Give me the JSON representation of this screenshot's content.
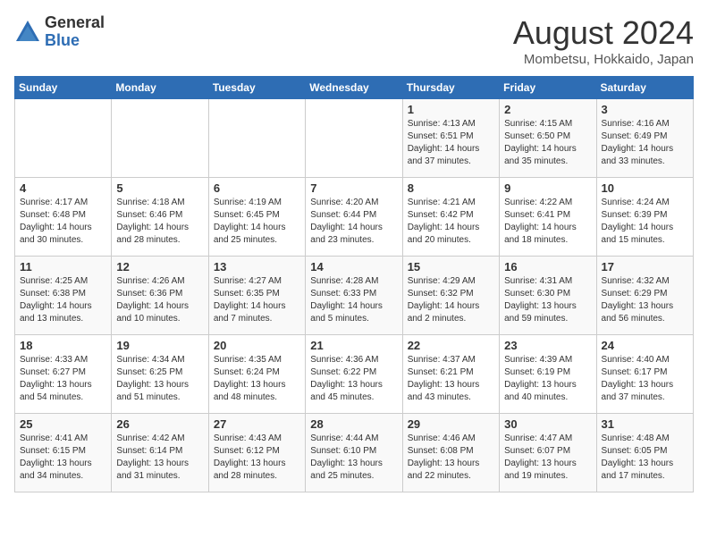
{
  "logo": {
    "general": "General",
    "blue": "Blue"
  },
  "title": {
    "month_year": "August 2024",
    "location": "Mombetsu, Hokkaido, Japan"
  },
  "weekdays": [
    "Sunday",
    "Monday",
    "Tuesday",
    "Wednesday",
    "Thursday",
    "Friday",
    "Saturday"
  ],
  "weeks": [
    [
      {
        "day": "",
        "content": ""
      },
      {
        "day": "",
        "content": ""
      },
      {
        "day": "",
        "content": ""
      },
      {
        "day": "",
        "content": ""
      },
      {
        "day": "1",
        "content": "Sunrise: 4:13 AM\nSunset: 6:51 PM\nDaylight: 14 hours\nand 37 minutes."
      },
      {
        "day": "2",
        "content": "Sunrise: 4:15 AM\nSunset: 6:50 PM\nDaylight: 14 hours\nand 35 minutes."
      },
      {
        "day": "3",
        "content": "Sunrise: 4:16 AM\nSunset: 6:49 PM\nDaylight: 14 hours\nand 33 minutes."
      }
    ],
    [
      {
        "day": "4",
        "content": "Sunrise: 4:17 AM\nSunset: 6:48 PM\nDaylight: 14 hours\nand 30 minutes."
      },
      {
        "day": "5",
        "content": "Sunrise: 4:18 AM\nSunset: 6:46 PM\nDaylight: 14 hours\nand 28 minutes."
      },
      {
        "day": "6",
        "content": "Sunrise: 4:19 AM\nSunset: 6:45 PM\nDaylight: 14 hours\nand 25 minutes."
      },
      {
        "day": "7",
        "content": "Sunrise: 4:20 AM\nSunset: 6:44 PM\nDaylight: 14 hours\nand 23 minutes."
      },
      {
        "day": "8",
        "content": "Sunrise: 4:21 AM\nSunset: 6:42 PM\nDaylight: 14 hours\nand 20 minutes."
      },
      {
        "day": "9",
        "content": "Sunrise: 4:22 AM\nSunset: 6:41 PM\nDaylight: 14 hours\nand 18 minutes."
      },
      {
        "day": "10",
        "content": "Sunrise: 4:24 AM\nSunset: 6:39 PM\nDaylight: 14 hours\nand 15 minutes."
      }
    ],
    [
      {
        "day": "11",
        "content": "Sunrise: 4:25 AM\nSunset: 6:38 PM\nDaylight: 14 hours\nand 13 minutes."
      },
      {
        "day": "12",
        "content": "Sunrise: 4:26 AM\nSunset: 6:36 PM\nDaylight: 14 hours\nand 10 minutes."
      },
      {
        "day": "13",
        "content": "Sunrise: 4:27 AM\nSunset: 6:35 PM\nDaylight: 14 hours\nand 7 minutes."
      },
      {
        "day": "14",
        "content": "Sunrise: 4:28 AM\nSunset: 6:33 PM\nDaylight: 14 hours\nand 5 minutes."
      },
      {
        "day": "15",
        "content": "Sunrise: 4:29 AM\nSunset: 6:32 PM\nDaylight: 14 hours\nand 2 minutes."
      },
      {
        "day": "16",
        "content": "Sunrise: 4:31 AM\nSunset: 6:30 PM\nDaylight: 13 hours\nand 59 minutes."
      },
      {
        "day": "17",
        "content": "Sunrise: 4:32 AM\nSunset: 6:29 PM\nDaylight: 13 hours\nand 56 minutes."
      }
    ],
    [
      {
        "day": "18",
        "content": "Sunrise: 4:33 AM\nSunset: 6:27 PM\nDaylight: 13 hours\nand 54 minutes."
      },
      {
        "day": "19",
        "content": "Sunrise: 4:34 AM\nSunset: 6:25 PM\nDaylight: 13 hours\nand 51 minutes."
      },
      {
        "day": "20",
        "content": "Sunrise: 4:35 AM\nSunset: 6:24 PM\nDaylight: 13 hours\nand 48 minutes."
      },
      {
        "day": "21",
        "content": "Sunrise: 4:36 AM\nSunset: 6:22 PM\nDaylight: 13 hours\nand 45 minutes."
      },
      {
        "day": "22",
        "content": "Sunrise: 4:37 AM\nSunset: 6:21 PM\nDaylight: 13 hours\nand 43 minutes."
      },
      {
        "day": "23",
        "content": "Sunrise: 4:39 AM\nSunset: 6:19 PM\nDaylight: 13 hours\nand 40 minutes."
      },
      {
        "day": "24",
        "content": "Sunrise: 4:40 AM\nSunset: 6:17 PM\nDaylight: 13 hours\nand 37 minutes."
      }
    ],
    [
      {
        "day": "25",
        "content": "Sunrise: 4:41 AM\nSunset: 6:15 PM\nDaylight: 13 hours\nand 34 minutes."
      },
      {
        "day": "26",
        "content": "Sunrise: 4:42 AM\nSunset: 6:14 PM\nDaylight: 13 hours\nand 31 minutes."
      },
      {
        "day": "27",
        "content": "Sunrise: 4:43 AM\nSunset: 6:12 PM\nDaylight: 13 hours\nand 28 minutes."
      },
      {
        "day": "28",
        "content": "Sunrise: 4:44 AM\nSunset: 6:10 PM\nDaylight: 13 hours\nand 25 minutes."
      },
      {
        "day": "29",
        "content": "Sunrise: 4:46 AM\nSunset: 6:08 PM\nDaylight: 13 hours\nand 22 minutes."
      },
      {
        "day": "30",
        "content": "Sunrise: 4:47 AM\nSunset: 6:07 PM\nDaylight: 13 hours\nand 19 minutes."
      },
      {
        "day": "31",
        "content": "Sunrise: 4:48 AM\nSunset: 6:05 PM\nDaylight: 13 hours\nand 17 minutes."
      }
    ]
  ]
}
